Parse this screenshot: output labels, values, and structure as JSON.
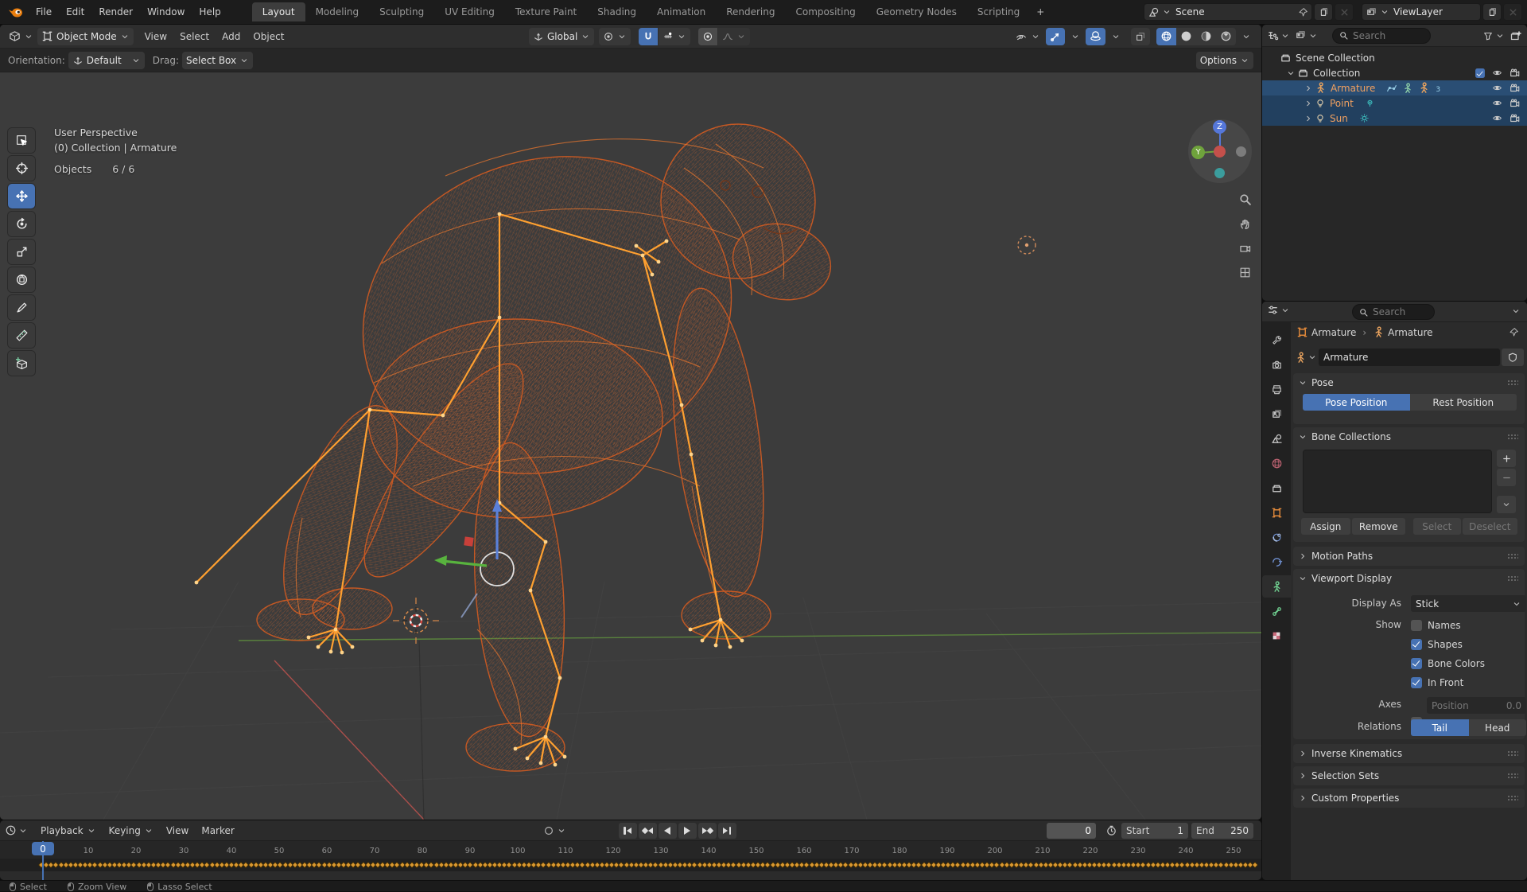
{
  "app": {
    "accent": "#4772b3",
    "selection_orange": "#ff9e2c",
    "keyframe_orange": "#d9972f"
  },
  "topbar": {
    "menus": [
      "File",
      "Edit",
      "Render",
      "Window",
      "Help"
    ],
    "tabs": [
      {
        "label": "Layout",
        "active": true
      },
      {
        "label": "Modeling"
      },
      {
        "label": "Sculpting"
      },
      {
        "label": "UV Editing"
      },
      {
        "label": "Texture Paint"
      },
      {
        "label": "Shading"
      },
      {
        "label": "Animation"
      },
      {
        "label": "Rendering"
      },
      {
        "label": "Compositing"
      },
      {
        "label": "Geometry Nodes"
      },
      {
        "label": "Scripting"
      }
    ],
    "new_workspace_label": "+",
    "scene_value": "Scene",
    "viewlayer_value": "ViewLayer"
  },
  "viewport_header": {
    "mode_value": "Object Mode",
    "menus": [
      "View",
      "Select",
      "Add",
      "Object"
    ],
    "orientation_value": "Global"
  },
  "tool_settings": {
    "orientation_label": "Orientation:",
    "orientation_value": "Default",
    "drag_label": "Drag:",
    "drag_value": "Select Box",
    "options_label": "Options"
  },
  "toolbar": {
    "tools": [
      {
        "name": "select-box",
        "active": false
      },
      {
        "name": "cursor",
        "active": false
      },
      {
        "name": "move",
        "active": true
      },
      {
        "name": "rotate",
        "active": false
      },
      {
        "name": "scale",
        "active": false
      },
      {
        "name": "transform",
        "active": false
      },
      {
        "name": "annotate",
        "active": false
      },
      {
        "name": "measure",
        "active": false
      },
      {
        "name": "add-cube",
        "active": false
      }
    ]
  },
  "viewport": {
    "perspective_label": "User Perspective",
    "context_label": "(0) Collection | Armature",
    "objects_label": "Objects",
    "objects_value": "6 / 6",
    "axis_z_label": "Z",
    "axis_y_label": "Y"
  },
  "outliner": {
    "search_placeholder": "Search",
    "rows": [
      {
        "label": "Scene Collection",
        "icon": "collection",
        "level": 0,
        "chevron": "none",
        "selected": false,
        "right": []
      },
      {
        "label": "Collection",
        "icon": "collection",
        "level": 1,
        "chevron": "down",
        "selected": false,
        "right": [
          "checkbox",
          "eye",
          "camera"
        ]
      },
      {
        "label": "Armature",
        "icon": "armature",
        "level": 2,
        "chevron": "right",
        "selected": true,
        "active": true,
        "extras": [
          "fcurve",
          "pose",
          "armature",
          "mesh"
        ],
        "mesh_badge": "3",
        "right": [
          "eye",
          "camera"
        ]
      },
      {
        "label": "Point",
        "icon": "light",
        "level": 2,
        "chevron": "right",
        "selected": true,
        "extras": [
          "point-badge"
        ],
        "right": [
          "eye",
          "camera"
        ]
      },
      {
        "label": "Sun",
        "icon": "light",
        "level": 2,
        "chevron": "right",
        "selected": true,
        "extras": [
          "sun-badge"
        ],
        "right": [
          "eye",
          "camera"
        ]
      }
    ]
  },
  "properties": {
    "search_placeholder": "Search",
    "tabs": [
      {
        "name": "tool",
        "color": "#c9c9c9"
      },
      {
        "name": "render",
        "color": "#c9c9c9"
      },
      {
        "name": "output",
        "color": "#c9c9c9"
      },
      {
        "name": "view-layer",
        "color": "#c9c9c9"
      },
      {
        "name": "scene",
        "color": "#c9c9c9"
      },
      {
        "name": "world",
        "color": "#b express5f6d",
        "color2": "#b55f6d"
      },
      {
        "name": "collection",
        "color": "#dadada"
      },
      {
        "name": "object",
        "color": "#e0883a"
      },
      {
        "name": "constraints",
        "color": "#6f8fd0"
      },
      {
        "name": "physics",
        "color": "#6f8fd0"
      },
      {
        "name": "object-data",
        "color": "#6fce8f",
        "active": true
      },
      {
        "name": "bone",
        "color": "#6fce8f"
      },
      {
        "name": "texture",
        "color": "#c96a7a"
      }
    ],
    "breadcrumb": {
      "object": "Armature",
      "separator": "›",
      "data": "Armature"
    },
    "name_value": "Armature",
    "pose": {
      "title": "Pose",
      "pose_position_label": "Pose Position",
      "rest_position_label": "Rest Position",
      "active": "pose"
    },
    "bone_collections": {
      "title": "Bone Collections",
      "assign_label": "Assign",
      "remove_label": "Remove",
      "select_label": "Select",
      "deselect_label": "Deselect"
    },
    "motion_paths_title": "Motion Paths",
    "viewport_display": {
      "title": "Viewport Display",
      "display_as_label": "Display As",
      "display_as_value": "Stick",
      "show_label": "Show",
      "checkboxes": [
        {
          "label": "Names",
          "checked": false
        },
        {
          "label": "Shapes",
          "checked": true
        },
        {
          "label": "Bone Colors",
          "checked": true
        },
        {
          "label": "In Front",
          "checked": true
        }
      ],
      "axes_label": "Axes",
      "axes_checked": false,
      "position_label": "Position",
      "position_value": "0.0",
      "relations_label": "Relations",
      "tail_label": "Tail",
      "head_label": "Head",
      "relations_active": "Tail"
    },
    "collapsed_sections": [
      "Inverse Kinematics",
      "Selection Sets",
      "Custom Properties"
    ]
  },
  "timeline": {
    "menus": [
      {
        "label": "Playback",
        "chevron": true
      },
      {
        "label": "Keying",
        "chevron": true
      },
      {
        "label": "View",
        "chevron": false
      },
      {
        "label": "Marker",
        "chevron": false
      }
    ],
    "current_frame": "0",
    "playhead_frame": "0",
    "start_label": "Start",
    "start_value": "1",
    "end_label": "End",
    "end_value": "250",
    "ticks": [
      0,
      10,
      20,
      30,
      40,
      50,
      60,
      70,
      80,
      90,
      100,
      110,
      120,
      130,
      140,
      150,
      160,
      170,
      180,
      190,
      200,
      210,
      220,
      230,
      240,
      250
    ],
    "keyframe_count": 250
  },
  "statusbar": {
    "items": [
      "Select",
      "Zoom View",
      "Lasso Select"
    ]
  }
}
